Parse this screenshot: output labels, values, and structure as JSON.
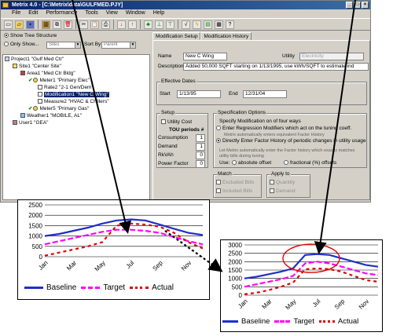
{
  "window": {
    "title": "Metrix 4.0 - [C:\\Metrix\\data\\GULFMED.PJY]",
    "buttons": [
      "_",
      "□",
      "×"
    ]
  },
  "menu": [
    "File",
    "Edit",
    "Performance",
    "Tools",
    "View",
    "Window",
    "Help"
  ],
  "toolbar_icons": [
    "new-icon",
    "open-icon",
    "save-icon",
    "library-icon",
    "copy-icon",
    "delete-icon",
    "cut-icon",
    "paste-icon",
    "print-icon",
    "down-arrow-icon",
    "up-arrow-icon",
    "tree-icon",
    "tree2-icon",
    "tree3-icon",
    "formula-icon",
    "lightning-icon",
    "chart-icon",
    "calculator-icon",
    "help-icon"
  ],
  "tree_panel": {
    "show_tree_label": "Show Tree Structure",
    "only_show_label": "Only Show...",
    "only_show_value": "Sites",
    "sort_by_label": "Sort By",
    "sort_by_value": "Parent",
    "nodes": [
      "Project1 \"Gulf Med Ctr\"",
      "Site1 \"Center Site\"",
      "Area1 \"Med Ctr Bldg\"",
      "Meter1 \"Primary Elec\"",
      "Rate2 \"2-1 Gen/Dem\"",
      "Modification1 \"New C Wing\"",
      "Measure2 \"HVAC & Chillers\"",
      "Meter5 \"Primary Gas\"",
      "Weather1 \"MOBILE, AL\"",
      "User1 \"GEA\""
    ]
  },
  "detail_panel": {
    "tabs": [
      "Modification Setup",
      "Modification History"
    ],
    "name_label": "Name",
    "name_value": "New C Wing",
    "utility_label": "Utility",
    "utility_value": "Electricity",
    "description_label": "Description",
    "description_value": "Added 50,000 SQFT starting on 1/13/1995, use kWh/SQFT to estimate ind",
    "effective_dates_label": "Effective Dates",
    "start_label": "Start",
    "start_value": "1/13/95",
    "end_label": "End",
    "end_value": "12/31/04",
    "setup_label": "Setup",
    "utility_cost_label": "Utility Cost",
    "tou_label": "TOU periods #",
    "fields": [
      {
        "label": "Consumption",
        "value": "1"
      },
      {
        "label": "Demand",
        "value": "1"
      },
      {
        "label": "RkVAh",
        "value": "0"
      },
      {
        "label": "Power Factor",
        "value": "0"
      }
    ],
    "spec_label": "Specification Options",
    "spec_intro": "Specify Modification on of four ways",
    "spec_opt1": "Enter Regression Modifiers which act on the tuning coeff.",
    "spec_opt1_note": "Metrix automatically enters equivalent Factor History",
    "spec_opt2": "Directly Enter Factor History of periodic changes in utility usage",
    "spec_note": "Let Metrix automatically enter the Factor history which exactly matches utility bills during tuning",
    "use_label": "Use:",
    "absolute_label": "absolute offset",
    "fractional_label": "fractional (%) offsets",
    "match_label": "Match",
    "excluded_bills": "Excluded Bills",
    "included_bills": "Included Bills",
    "apply_to_label": "Apply to",
    "quantity_label": "Quantity",
    "demand_label": "Demand"
  },
  "chart_data": [
    {
      "type": "line",
      "categories": [
        "Jan",
        "Feb",
        "Mar",
        "Apr",
        "May",
        "Jun",
        "Jul",
        "Aug",
        "Sep",
        "Oct",
        "Nov",
        "Dec"
      ],
      "x_tick_labels": [
        "Jan",
        "Mar",
        "May",
        "Jul",
        "Sep",
        "Nov"
      ],
      "ylim": [
        0,
        2500
      ],
      "yticks": [
        "0",
        "500",
        "1000",
        "1500",
        "2000",
        "2500"
      ],
      "series": [
        {
          "name": "Baseline",
          "color": "#1f2fc8",
          "dash": "solid",
          "values": [
            1000,
            1100,
            1250,
            1400,
            1600,
            1750,
            1800,
            1750,
            1550,
            1350,
            1150,
            1050
          ]
        },
        {
          "name": "Target",
          "color": "#ff00ff",
          "dash": "dashed",
          "values": [
            600,
            750,
            900,
            1050,
            1200,
            1300,
            1300,
            1250,
            1150,
            950,
            750,
            600
          ]
        },
        {
          "name": "Actual",
          "color": "#e00000",
          "dash": "dotted",
          "values": [
            50,
            200,
            350,
            500,
            700,
            1500,
            1600,
            1550,
            1450,
            1150,
            700,
            400
          ]
        }
      ],
      "highlight": false
    },
    {
      "type": "line",
      "categories": [
        "Jan",
        "Feb",
        "Mar",
        "Apr",
        "May",
        "Jun",
        "Jul",
        "Aug",
        "Sep",
        "Oct",
        "Nov",
        "Dec"
      ],
      "x_tick_labels": [
        "Jan",
        "Mar",
        "May",
        "Jul",
        "Sep",
        "Nov"
      ],
      "ylim": [
        0,
        3000
      ],
      "yticks": [
        "0",
        "500",
        "1000",
        "1500",
        "2000",
        "2500",
        "3000"
      ],
      "series": [
        {
          "name": "Baseline",
          "color": "#1f2fc8",
          "dash": "solid",
          "values": [
            1000,
            1100,
            1250,
            1400,
            1600,
            2400,
            2450,
            2400,
            2200,
            2000,
            1800,
            1700
          ]
        },
        {
          "name": "Target",
          "color": "#ff00ff",
          "dash": "dashed",
          "values": [
            500,
            650,
            800,
            950,
            1150,
            1900,
            2000,
            1900,
            1700,
            1500,
            1300,
            1200
          ]
        },
        {
          "name": "Actual",
          "color": "#e00000",
          "dash": "dotted",
          "values": [
            50,
            150,
            300,
            500,
            750,
            1550,
            1600,
            1550,
            1400,
            1150,
            900,
            800
          ]
        }
      ],
      "highlight": true,
      "highlight_color": "#e00000"
    }
  ]
}
